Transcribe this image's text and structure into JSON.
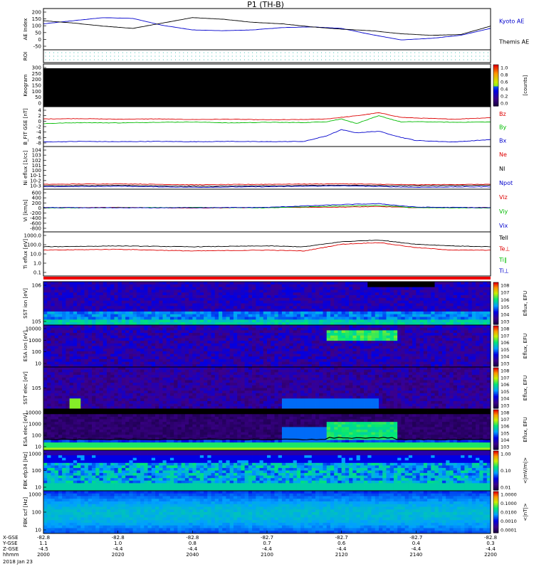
{
  "chart_data": {
    "type": "line",
    "title": "P1 (TH-B)",
    "panels": [
      {
        "id": "ae",
        "ylabel": "AE Index",
        "ylim": [
          -50,
          200
        ],
        "yticks": [
          "200",
          "150",
          "100",
          "50",
          "0",
          "-50"
        ],
        "legend": [
          "Kyoto AE",
          "Themis AE"
        ],
        "legend_colors": [
          "#0000cc",
          "#000000"
        ],
        "series": [
          {
            "name": "Kyoto AE",
            "x": [
              0,
              4,
              8,
              12,
              16,
              20,
              24,
              28,
              32,
              36,
              40,
              44,
              48,
              52,
              56,
              60
            ],
            "values": [
              110,
              130,
              150,
              145,
              100,
              70,
              65,
              70,
              85,
              90,
              80,
              40,
              5,
              15,
              35,
              80
            ]
          },
          {
            "name": "Themis AE",
            "x": [
              0,
              4,
              8,
              12,
              16,
              20,
              24,
              28,
              32,
              36,
              40,
              44,
              48,
              52,
              56,
              60
            ],
            "values": [
              130,
              115,
              95,
              80,
              115,
              150,
              140,
              120,
              110,
              90,
              75,
              65,
              45,
              35,
              40,
              95
            ]
          }
        ]
      },
      {
        "id": "roi",
        "ylabel": "ROI",
        "yticks": []
      },
      {
        "id": "keogram",
        "ylabel": "Keogram",
        "ylim": [
          0,
          300
        ],
        "yticks": [
          "300",
          "250",
          "200",
          "150",
          "100",
          "50",
          "0"
        ],
        "colorbar": {
          "label": "[counts]",
          "ticks": [
            "1.0",
            "0.8",
            "0.6",
            "0.4",
            "0.2",
            "0.0"
          ]
        }
      },
      {
        "id": "bfield",
        "ylabel": "B_FIT GSE [nT]",
        "ylim": [
          -8,
          4
        ],
        "yticks": [
          "4",
          "2",
          "0",
          "-2",
          "-4",
          "-6",
          "-8"
        ],
        "legend": [
          "Bz",
          "By",
          "Bx"
        ],
        "legend_colors": [
          "#dd0000",
          "#00bb00",
          "#0000cc"
        ],
        "series": [
          {
            "name": "Bz",
            "x": [
              0,
              5,
              10,
              15,
              20,
              25,
              30,
              35,
              38,
              40,
              42,
              45,
              48,
              50,
              55,
              60
            ],
            "values": [
              0.5,
              0.6,
              0.4,
              0.5,
              0.3,
              0.4,
              0.2,
              0.3,
              0.5,
              1.0,
              1.5,
              2.5,
              1.0,
              0.8,
              0.4,
              0.9
            ]
          },
          {
            "name": "By",
            "x": [
              0,
              5,
              10,
              15,
              20,
              25,
              30,
              35,
              38,
              40,
              42,
              45,
              48,
              50,
              55,
              60
            ],
            "values": [
              -1.0,
              -0.7,
              -0.8,
              -0.6,
              -0.5,
              -0.8,
              -0.6,
              -0.7,
              -0.4,
              0.5,
              -1.0,
              1.5,
              -0.5,
              -0.4,
              -0.6,
              -0.5
            ]
          },
          {
            "name": "Bx",
            "x": [
              0,
              5,
              10,
              15,
              20,
              25,
              30,
              35,
              38,
              40,
              42,
              45,
              48,
              50,
              55,
              60
            ],
            "values": [
              -7.0,
              -6.8,
              -6.9,
              -6.8,
              -6.9,
              -6.8,
              -6.9,
              -6.8,
              -5.0,
              -3.0,
              -4.0,
              -3.5,
              -5.5,
              -6.5,
              -7.0,
              -6.2
            ]
          }
        ]
      },
      {
        "id": "density",
        "ylabel": "Ni eflux [1/cc]",
        "ylim": [
          -3,
          5
        ],
        "yticks": [
          "10^4",
          "10^3",
          "10^2",
          "10^1",
          "10^0",
          "10^-1",
          "10^-2",
          "10^-3"
        ],
        "legend": [
          "Ne",
          "NI",
          "Npot"
        ],
        "legend_colors": [
          "#dd0000",
          "#000000",
          "#0000cc"
        ],
        "series": [
          {
            "name": "Ne",
            "x": [
              0,
              10,
              20,
              30,
              40,
              50,
              60
            ],
            "values": [
              -2.3,
              -2.2,
              -2.4,
              -2.3,
              -2.2,
              -2.4,
              -2.3
            ]
          },
          {
            "name": "NI",
            "x": [
              0,
              10,
              20,
              30,
              40,
              50,
              60
            ],
            "values": [
              -2.6,
              -2.5,
              -2.7,
              -2.6,
              -2.5,
              -2.6,
              -2.5
            ]
          },
          {
            "name": "Npot",
            "x": [
              0,
              10,
              20,
              30,
              40,
              50,
              60
            ],
            "values": [
              -2.8,
              -2.7,
              -2.9,
              -2.8,
              -2.6,
              -2.9,
              -2.8
            ]
          }
        ]
      },
      {
        "id": "velocity",
        "ylabel": "Vi [km/s]",
        "ylim": [
          -800,
          600
        ],
        "yticks": [
          "600",
          "400",
          "200",
          "0",
          "-200",
          "-400",
          "-600",
          "-800"
        ],
        "legend": [
          "Viz",
          "Viy",
          "Vix"
        ],
        "legend_colors": [
          "#dd0000",
          "#00bb00",
          "#0000cc"
        ],
        "series": [
          {
            "name": "Viz",
            "x": [
              0,
              10,
              20,
              30,
              40,
              45,
              50,
              60
            ],
            "values": [
              0,
              10,
              -10,
              5,
              20,
              40,
              0,
              10
            ]
          },
          {
            "name": "Viy",
            "x": [
              0,
              10,
              20,
              30,
              40,
              45,
              50,
              60
            ],
            "values": [
              -10,
              0,
              10,
              -5,
              60,
              80,
              0,
              -10
            ]
          },
          {
            "name": "Vix",
            "x": [
              0,
              10,
              20,
              30,
              40,
              45,
              50,
              60
            ],
            "values": [
              5,
              -5,
              0,
              10,
              110,
              140,
              20,
              0
            ]
          }
        ]
      },
      {
        "id": "temperature",
        "ylabel": "Ti eflux [eV]",
        "ylim": [
          -1.3,
          3.6
        ],
        "yticks": [
          "1000.0",
          "100.0",
          "10.0",
          "1.0",
          "0.1"
        ],
        "legend": [
          "Tell",
          "Te⊥",
          "Ti∥",
          "Ti⊥"
        ],
        "legend_colors": [
          "#000000",
          "#dd0000",
          "#00bb00",
          "#0000cc"
        ],
        "series": [
          {
            "name": "Ti",
            "x": [
              0,
              10,
              20,
              30,
              35,
              40,
              45,
              50,
              55,
              60
            ],
            "values": [
              2.0,
              2.1,
              2.0,
              2.1,
              2.0,
              2.6,
              2.8,
              2.3,
              2.1,
              2.0
            ]
          },
          {
            "name": "Te",
            "x": [
              0,
              10,
              20,
              30,
              35,
              40,
              45,
              50,
              55,
              60
            ],
            "values": [
              1.6,
              1.7,
              1.5,
              1.6,
              1.5,
              2.3,
              2.5,
              1.9,
              1.6,
              1.6
            ]
          }
        ]
      },
      {
        "id": "sst_ion",
        "ylabel": "SST ion [eV]",
        "yticks": [
          "10^6",
          "10^5"
        ],
        "colorbar": {
          "label": "Eflux, EFU",
          "ticks": [
            "10^8",
            "10^7",
            "10^6",
            "10^5",
            "10^4",
            "10^3"
          ]
        }
      },
      {
        "id": "esa_ion",
        "ylabel": "ESA ion [eV]",
        "yticks": [
          "10000",
          "1000",
          "100",
          "10"
        ],
        "colorbar": {
          "label": "Eflux, EFU",
          "ticks": [
            "10^8",
            "10^7",
            "10^6",
            "10^5",
            "10^4",
            "10^3"
          ]
        }
      },
      {
        "id": "sst_elec",
        "ylabel": "SST elec [eV]",
        "yticks": [
          "10^5"
        ],
        "colorbar": {
          "label": "Eflux, EFU",
          "ticks": [
            "10^8",
            "10^7",
            "10^6",
            "10^5",
            "10^4",
            "10^3"
          ]
        }
      },
      {
        "id": "esa_elec",
        "ylabel": "ESA elec [eV]",
        "yticks": [
          "10000",
          "1000",
          "100",
          "10"
        ],
        "colorbar": {
          "label": "Eflux, EFU",
          "ticks": [
            "10^8",
            "10^7",
            "10^6",
            "10^5",
            "10^4",
            "10^3"
          ]
        }
      },
      {
        "id": "fbk_e",
        "ylabel": "FBK efp34 [Hz]",
        "yticks": [
          "1000",
          "100",
          "10"
        ],
        "colorbar": {
          "label": "<|mV/m|>",
          "ticks": [
            "1.00",
            "0.10",
            "0.01"
          ]
        }
      },
      {
        "id": "fbk_b",
        "ylabel": "FBK scf [Hz]",
        "yticks": [
          "1000",
          "100",
          "10"
        ],
        "colorbar": {
          "label": "<|nT|>",
          "ticks": [
            "1.0000",
            "0.1000",
            "0.0100",
            "0.0010",
            "0.0001"
          ]
        }
      }
    ],
    "xaxis": {
      "row_labels": [
        "X-GSE",
        "Y-GSE",
        "Z-GSE",
        "hhmm",
        "2018 Jan 23"
      ],
      "columns": [
        [
          "-82.8",
          "1.1",
          "-4.5",
          "2000"
        ],
        [
          "-82.8",
          "1.0",
          "-4.4",
          "2020"
        ],
        [
          "-82.8",
          "0.8",
          "-4.4",
          "2040"
        ],
        [
          "-82.7",
          "0.7",
          "-4.4",
          "2100"
        ],
        [
          "-82.7",
          "0.6",
          "-4.4",
          "2120"
        ],
        [
          "-82.7",
          "0.4",
          "-4.4",
          "2140"
        ],
        [
          "-82.8",
          "0.3",
          "-4.4",
          "2200"
        ]
      ]
    }
  }
}
